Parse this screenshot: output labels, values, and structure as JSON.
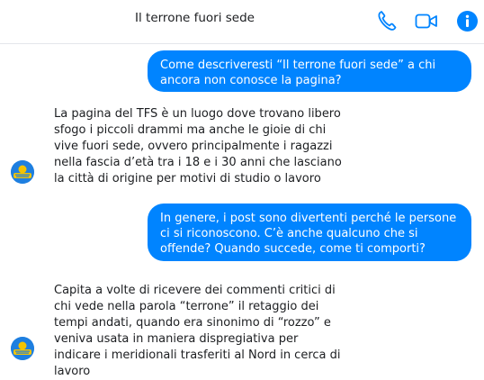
{
  "header": {
    "title": "Il terrone fuori sede",
    "icons": [
      "phone-icon",
      "video-camera-icon",
      "info-icon"
    ],
    "accent_color": "#0084ff"
  },
  "messages": [
    {
      "direction": "outgoing",
      "text": "Come descriveresti “Il terrone fuori sede” a chi ancora non conosce la pagina?"
    },
    {
      "direction": "incoming",
      "text": "La pagina del TFS è un luogo dove trovano libero sfogo i piccoli drammi ma anche le gioie di chi vive fuori sede, ovvero principalmente i ragazzi nella fascia d’età tra i 18 e i 30 anni che lasciano la città di origine per motivi di studio o lavoro"
    },
    {
      "direction": "outgoing",
      "text": "In genere, i post sono divertenti perché le persone ci si riconoscono. C’è anche qualcuno che si offende? Quando succede, come ti comporti?"
    },
    {
      "direction": "incoming",
      "text": "Capita a volte di ricevere dei commenti critici di chi vede nella parola “terrone” il retaggio dei tempi andati, quando era sinonimo di “rozzo” e veniva usata in maniera dispregiativa per indicare i meridionali trasferiti al Nord in cerca di lavoro"
    }
  ]
}
